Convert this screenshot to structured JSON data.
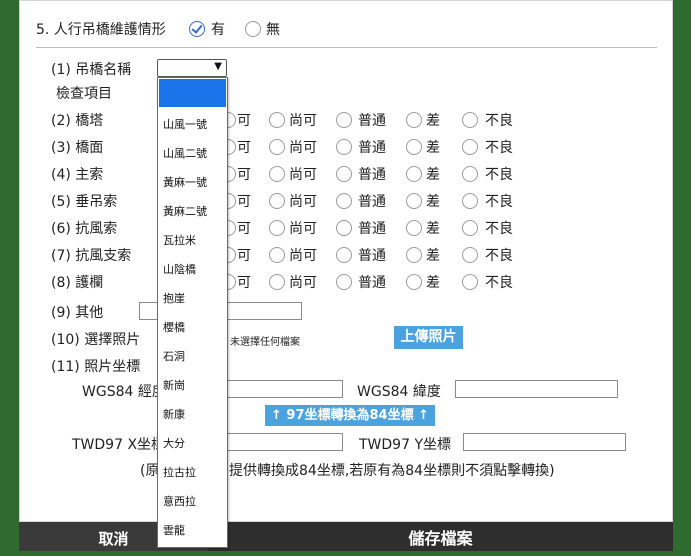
{
  "section": {
    "title": "5. 人行吊橋維護情形",
    "option_yes": "有",
    "option_no": "無"
  },
  "form": {
    "bridge_name_label": "(1) 吊橋名稱",
    "inspection_items_label": "檢查項目",
    "items": [
      {
        "label": "(2) 橋塔"
      },
      {
        "label": "(3) 橋面"
      },
      {
        "label": "(4) 主索"
      },
      {
        "label": "(5) 垂吊索"
      },
      {
        "label": "(6) 抗風索"
      },
      {
        "label": "(7) 抗風支索"
      },
      {
        "label": "(8) 護欄"
      }
    ],
    "rating_options": [
      "可",
      "尚可",
      "普通",
      "差",
      "不良"
    ],
    "other_label": "(9) 其他",
    "photo_select_label": "(10) 選擇照片",
    "no_file_text": "未選擇任何檔案",
    "upload_button": "上傳照片",
    "photo_coords_label": "(11) 照片坐標",
    "wgs84_lon_label": "WGS84 經度",
    "wgs84_lat_label": "WGS84 緯度",
    "convert_button": "↑ 97坐標轉換為84坐標 ↑",
    "twd97_x_label": "TWD97 X坐標",
    "twd97_y_label": "TWD97 Y坐標",
    "note_start": "(原",
    "note_end": "提供轉換成84坐標,若原有為84坐標則不須點擊轉換)"
  },
  "dropdown": {
    "selected_value": "",
    "options": [
      "",
      "山風一號",
      "山風二號",
      "黃麻一號",
      "黃麻二號",
      "瓦拉米",
      "山陰橋",
      "抱崖",
      "櫻橋",
      "石洞",
      "新崗",
      "新康",
      "大分",
      "拉古拉",
      "意西拉",
      "雲龍"
    ]
  },
  "footer": {
    "cancel_label": "取消",
    "save_label": "儲存檔案"
  },
  "colors": {
    "background": "#2f6b2f",
    "accent_blue": "#4aa3df",
    "selection_blue": "#1a73e8"
  }
}
